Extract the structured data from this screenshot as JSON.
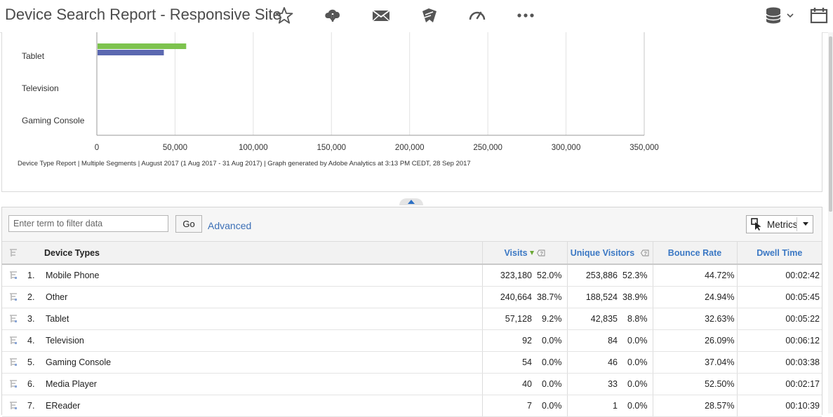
{
  "header": {
    "title": "Device Search Report - Responsive Site",
    "icons": [
      "star-icon",
      "cloud-download-icon",
      "email-icon",
      "bookmark-edit-icon",
      "dashboard-gauge-icon",
      "more-icon",
      "database-icon",
      "chevron-down-icon",
      "calendar-icon"
    ]
  },
  "chart_data": {
    "type": "bar",
    "orientation": "horizontal",
    "categories": [
      "Tablet",
      "Television",
      "Gaming Console"
    ],
    "series": [
      {
        "color": "#7dc34e",
        "values": [
          57128,
          92,
          54
        ]
      },
      {
        "color": "#5b68b0",
        "values": [
          42835,
          84,
          46
        ]
      }
    ],
    "xlim": [
      0,
      350000
    ],
    "xticks": [
      "0",
      "50,000",
      "100,000",
      "150,000",
      "200,000",
      "250,000",
      "300,000",
      "350,000"
    ],
    "xtick_values": [
      0,
      50000,
      100000,
      150000,
      200000,
      250000,
      300000,
      350000
    ],
    "grid": true,
    "footer": "Device Type Report | Multiple Segments | August 2017 (1 Aug 2017 - 31 Aug 2017) | Graph generated by Adobe Analytics at  3:13 PM CEDT, 28 Sep 2017"
  },
  "toolbar": {
    "filter_placeholder": "Enter term to filter data",
    "go_label": "Go",
    "advanced_label": "Advanced",
    "metrics_label": "Metrics"
  },
  "table": {
    "dimension_header": "Device Types",
    "columns": [
      "Visits",
      "Unique Visitors",
      "Bounce Rate",
      "Dwell Time"
    ],
    "rows": [
      {
        "rank": "1.",
        "name": "Mobile Phone",
        "visits": "323,180",
        "visits_pct": "52.0%",
        "uv": "253,886",
        "uv_pct": "52.3%",
        "bounce": "44.72%",
        "dwell": "00:02:42"
      },
      {
        "rank": "2.",
        "name": "Other",
        "visits": "240,664",
        "visits_pct": "38.7%",
        "uv": "188,524",
        "uv_pct": "38.9%",
        "bounce": "24.94%",
        "dwell": "00:05:45"
      },
      {
        "rank": "3.",
        "name": "Tablet",
        "visits": "57,128",
        "visits_pct": "9.2%",
        "uv": "42,835",
        "uv_pct": "8.8%",
        "bounce": "32.63%",
        "dwell": "00:05:22"
      },
      {
        "rank": "4.",
        "name": "Television",
        "visits": "92",
        "visits_pct": "0.0%",
        "uv": "84",
        "uv_pct": "0.0%",
        "bounce": "26.09%",
        "dwell": "00:06:12"
      },
      {
        "rank": "5.",
        "name": "Gaming Console",
        "visits": "54",
        "visits_pct": "0.0%",
        "uv": "46",
        "uv_pct": "0.0%",
        "bounce": "37.04%",
        "dwell": "00:03:38"
      },
      {
        "rank": "6.",
        "name": "Media Player",
        "visits": "40",
        "visits_pct": "0.0%",
        "uv": "33",
        "uv_pct": "0.0%",
        "bounce": "52.50%",
        "dwell": "00:02:17"
      },
      {
        "rank": "7.",
        "name": "EReader",
        "visits": "7",
        "visits_pct": "0.0%",
        "uv": "1",
        "uv_pct": "0.0%",
        "bounce": "28.57%",
        "dwell": "00:10:39"
      }
    ]
  }
}
